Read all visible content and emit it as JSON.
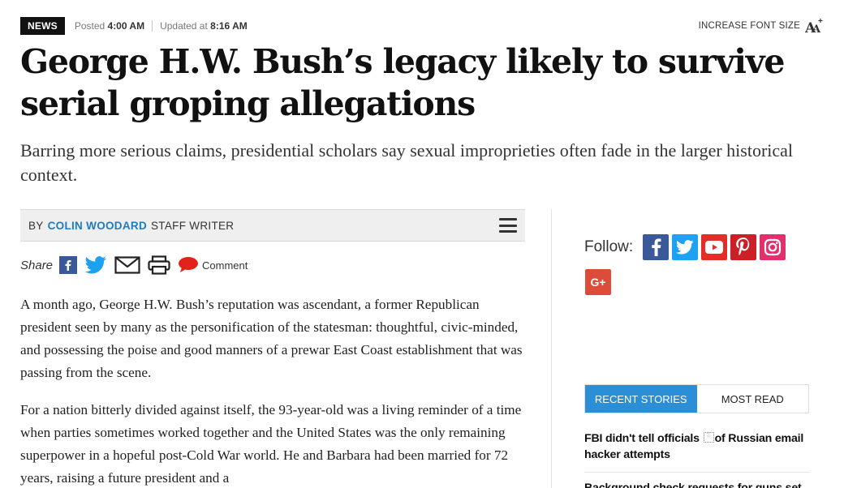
{
  "header": {
    "category": "NEWS",
    "posted_label": "Posted",
    "posted_time": "4:00 AM",
    "updated_label": "Updated at",
    "updated_time": "8:16 AM",
    "font_size_label": "INCREASE FONT SIZE"
  },
  "article": {
    "headline": "George H.W. Bush’s legacy likely to survive serial groping allegations",
    "dek": "Barring more serious claims, presidential scholars say sexual improprieties often fade in the larger historical context.",
    "byline_prefix": "BY",
    "author": "COLIN WOODARD",
    "author_title": "STAFF WRITER",
    "share_label": "Share",
    "comment_label": "Comment",
    "paragraphs": [
      "A month ago, George H.W. Bush’s reputation was ascendant, a former Republican president seen by many as the personification of the statesman: thoughtful, civic-minded, and possessing the poise and good manners of a prewar East Coast establishment that was passing from the scene.",
      "For a nation bitterly divided against itself, the 93-year-old was a living reminder of a time when parties sometimes worked together and the United States was the only remaining superpower in a hopeful post-Cold War world. He and Barbara had been married for 72 years, raising a future president and a"
    ]
  },
  "sidebar": {
    "follow_label": "Follow:",
    "social": [
      {
        "name": "facebook",
        "color": "#3b5998"
      },
      {
        "name": "twitter",
        "color": "#1da1f2"
      },
      {
        "name": "youtube",
        "color": "#e52d27"
      },
      {
        "name": "pinterest",
        "color": "#cb2027"
      },
      {
        "name": "instagram",
        "color": "#e1306c"
      },
      {
        "name": "google-plus",
        "color": "#dd4b39"
      }
    ],
    "tabs": [
      "RECENT STORIES",
      "MOST READ"
    ],
    "stories": [
      {
        "before": "FBI didn't tell officials ",
        "after": "of Russian email hacker attempts"
      },
      {
        "text": "Background check requests for guns set"
      }
    ]
  },
  "colors": {
    "accent": "#1f7bc1",
    "tab_active": "#2b8fd8"
  }
}
